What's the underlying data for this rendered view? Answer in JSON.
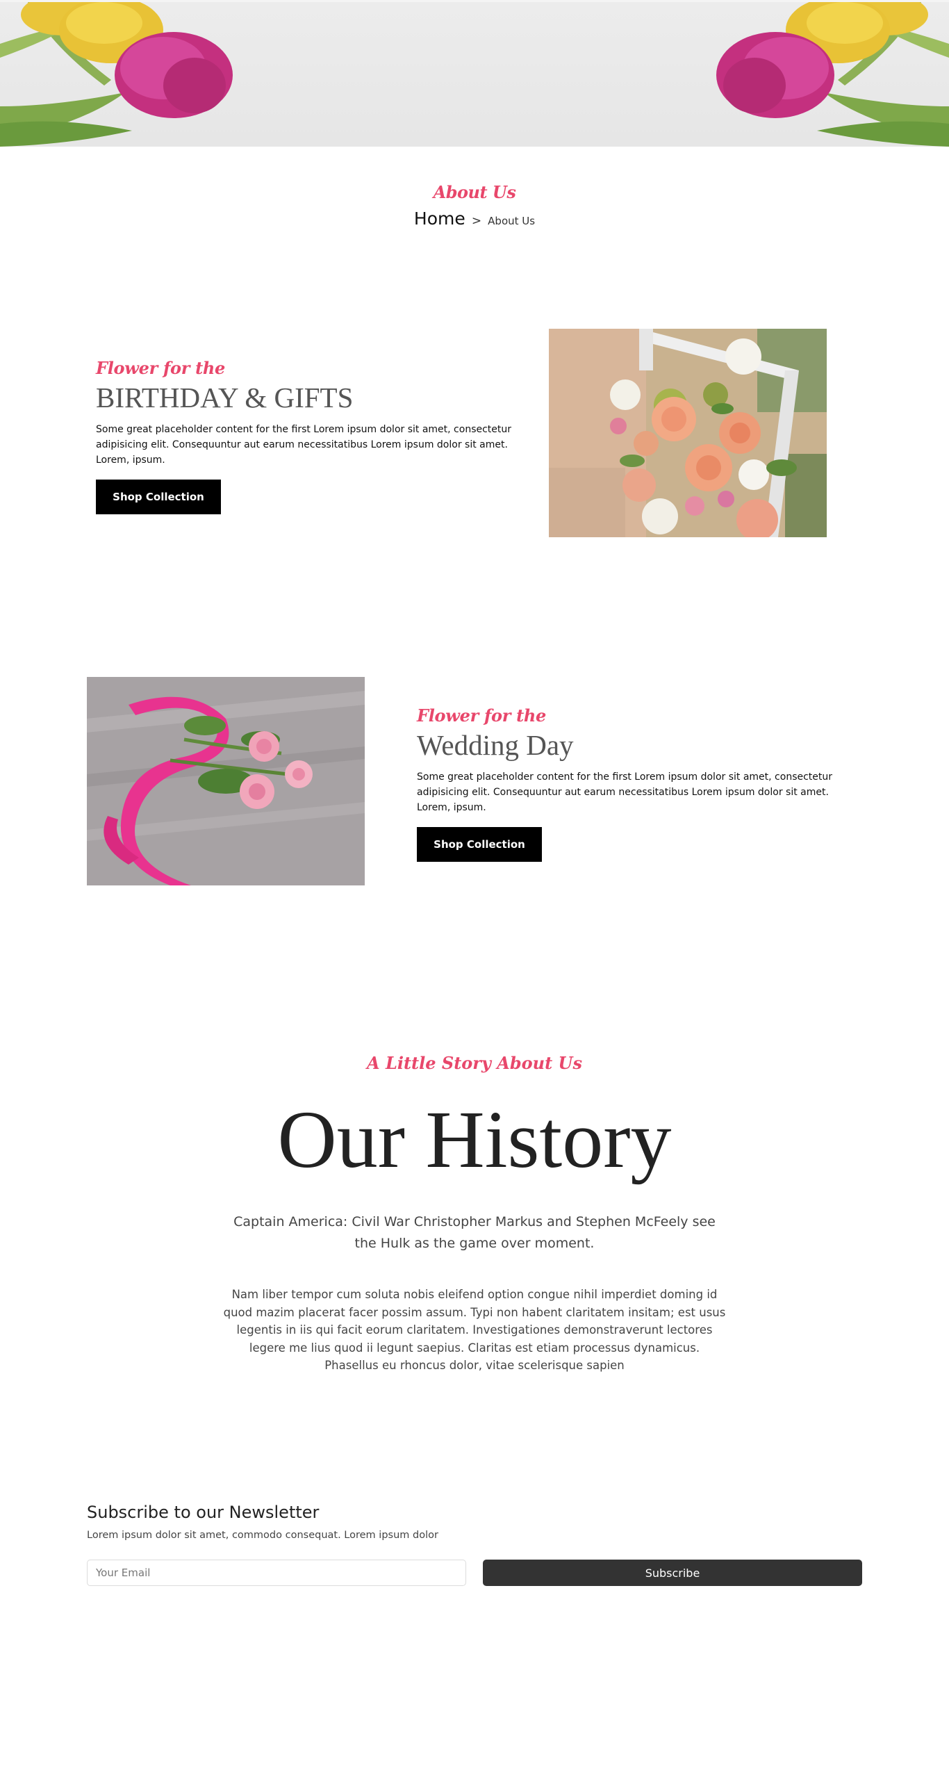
{
  "page_header": {
    "title": "About Us",
    "breadcrumb": {
      "home": "Home",
      "separator": ">",
      "current": "About Us"
    }
  },
  "features": [
    {
      "eyebrow": "Flower for the",
      "heading": "BIRTHDAY & GIFTS",
      "body": "Some great placeholder content for the first Lorem ipsum dolor sit amet, consectetur adipisicing elit. Consequuntur aut earum necessitatibus Lorem ipsum dolor sit amet. Lorem, ipsum.",
      "button": "Shop Collection"
    },
    {
      "eyebrow": "Flower for the",
      "heading": "Wedding Day",
      "body": "Some great placeholder content for the first Lorem ipsum dolor sit amet, consectetur adipisicing elit. Consequuntur aut earum necessitatibus Lorem ipsum dolor sit amet. Lorem, ipsum.",
      "button": "Shop Collection"
    }
  ],
  "history": {
    "eyebrow": "A Little Story About Us",
    "title": "Our History",
    "lead": "Captain America: Civil War Christopher Markus and Stephen McFeely see the Hulk as the game over moment.",
    "body": "Nam liber tempor cum soluta nobis eleifend option congue nihil imperdiet doming id quod mazim placerat facer possim assum. Typi non habent claritatem insitam; est usus legentis in iis qui facit eorum claritatem. Investigationes demonstraverunt lectores legere me lius quod ii legunt saepius. Claritas est etiam processus dynamicus. Phasellus eu rhoncus dolor, vitae scelerisque sapien"
  },
  "newsletter": {
    "title": "Subscribe to our Newsletter",
    "subtitle": "Lorem ipsum dolor sit amet, commodo consequat. Lorem ipsum dolor",
    "email_placeholder": "Your Email",
    "button": "Subscribe"
  },
  "colors": {
    "accent": "#e8476b",
    "button_dark": "#000000",
    "subscribe_button": "#333333",
    "heading_gray": "#555555"
  }
}
